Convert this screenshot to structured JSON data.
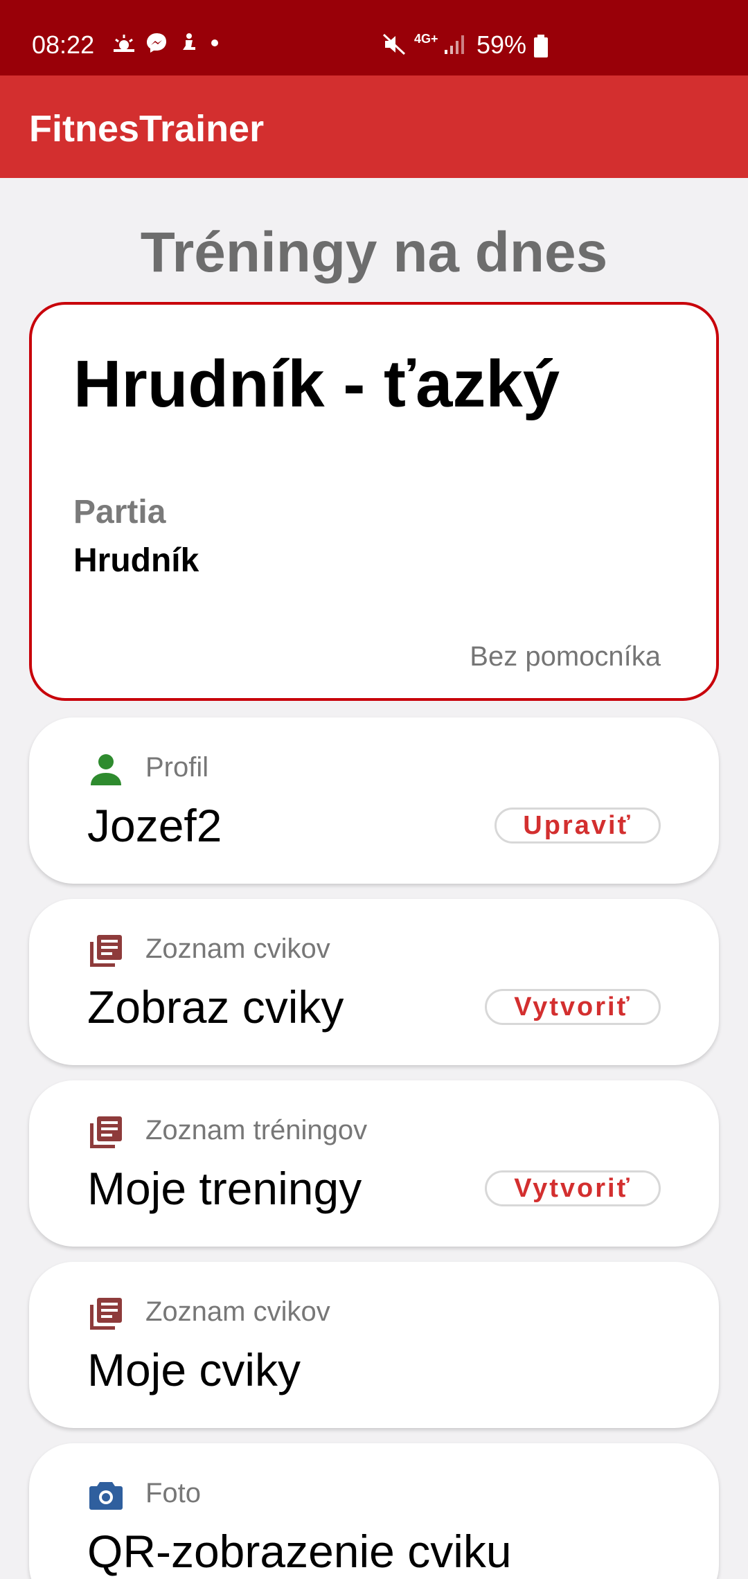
{
  "status_bar": {
    "time": "08:22",
    "network": "4G+",
    "battery": "59%"
  },
  "app": {
    "title": "FitnesTrainer"
  },
  "section_title": "Tréningy na dnes",
  "training": {
    "name": "Hrudník - ťazký",
    "partia_label": "Partia",
    "partia_value": "Hrudník",
    "helper": "Bez pomocníka"
  },
  "menu": [
    {
      "icon": "person-icon",
      "sub": "Profil",
      "main": "Jozef2",
      "action": "Upraviť",
      "icon_color": "#2e8b2e"
    },
    {
      "icon": "list-icon",
      "sub": "Zoznam cvikov",
      "main": "Zobraz cviky",
      "action": "Vytvoriť",
      "icon_color": "#8e3b3b"
    },
    {
      "icon": "list-icon",
      "sub": "Zoznam tréningov",
      "main": "Moje treningy",
      "action": "Vytvoriť",
      "icon_color": "#8e3b3b"
    },
    {
      "icon": "list-icon",
      "sub": "Zoznam cvikov",
      "main": "Moje cviky",
      "action": "",
      "icon_color": "#8e3b3b"
    },
    {
      "icon": "camera-icon",
      "sub": "Foto",
      "main": "QR-zobrazenie cviku",
      "action": "",
      "icon_color": "#2f5f9e"
    }
  ],
  "colors": {
    "status_bar": "#990008",
    "app_bar": "#d32f2f",
    "accent": "#c8000a"
  }
}
